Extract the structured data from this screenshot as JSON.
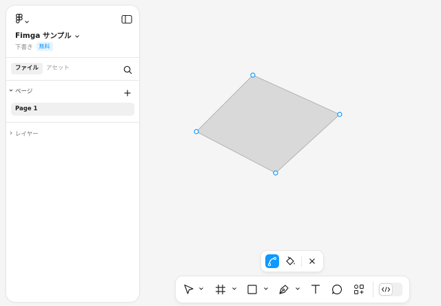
{
  "file": {
    "title": "Fimga サンプル",
    "status": "下書き",
    "plan": "無料"
  },
  "tabs": {
    "files": "ファイル",
    "assets": "アセット"
  },
  "pages": {
    "header": "ページ",
    "items": [
      "Page 1"
    ]
  },
  "layers": {
    "header": "レイヤー"
  },
  "colors": {
    "accent": "#0d99ff",
    "shape_fill": "#d9d9d9",
    "shape_stroke": "#b3b3b3",
    "canvas": "#f5f5f5"
  },
  "icons": {
    "main_menu": "figma-logo-icon",
    "panel_toggle": "sidebar-toggle-icon",
    "search": "search-icon",
    "add_page": "plus-icon",
    "context_bar": [
      "bend-path-icon",
      "paint-bucket-icon",
      "close-icon"
    ],
    "toolbar": [
      "move-tool-icon",
      "frame-tool-icon",
      "rectangle-tool-icon",
      "pen-tool-icon",
      "text-tool-icon",
      "comment-tool-icon",
      "actions-icon",
      "dev-mode-icon"
    ]
  }
}
